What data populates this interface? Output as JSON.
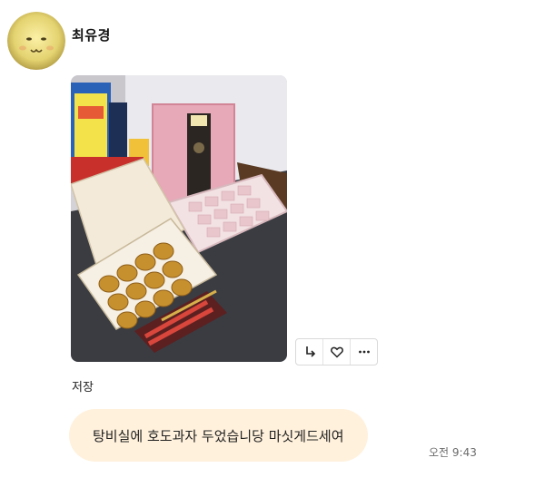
{
  "message": {
    "sender": "최유경",
    "actions": {
      "reply_icon": "reply-arrow-icon",
      "like_icon": "heart-icon",
      "more_icon": "ellipsis-icon"
    },
    "save_label": "저장",
    "text": "탕비실에 호도과자 두었습니당 마싯게드세여",
    "time": "오전 9:43"
  },
  "colors": {
    "bubble": "#fff1dc",
    "avatar": "#e8d77a",
    "time_text": "#6a6a6a"
  }
}
